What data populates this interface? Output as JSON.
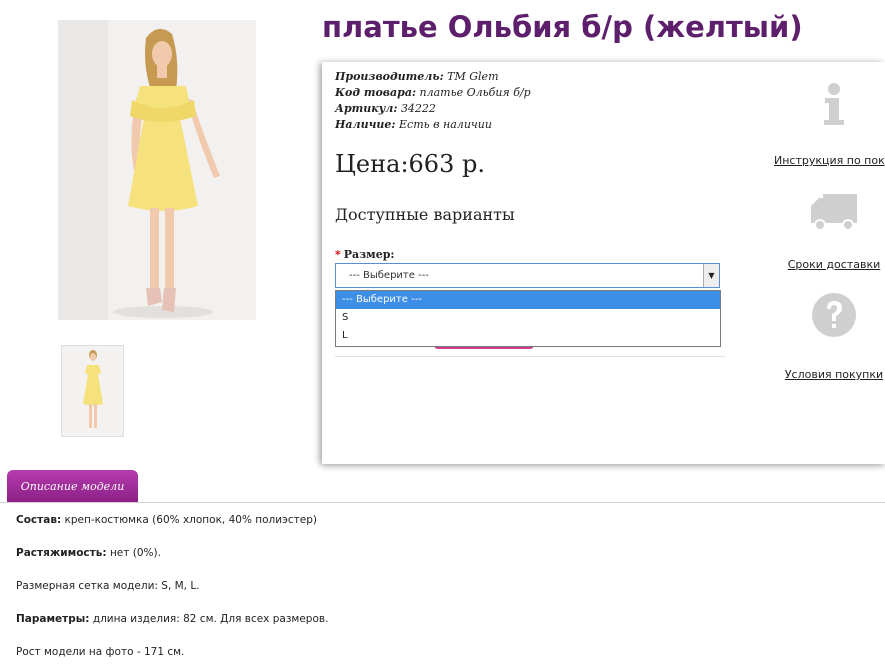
{
  "product": {
    "title": "платье Ольбия б/р (желтый)"
  },
  "specs": {
    "manufacturer_label": "Производитель:",
    "manufacturer_value": "TM Glem",
    "code_label": "Код товара:",
    "code_value": "платье Ольбия б/р",
    "article_label": "Артикул:",
    "article_value": "34222",
    "availability_label": "Наличие:",
    "availability_value": "Есть в наличии"
  },
  "price": "Цена:663 р.",
  "variants_title": "Доступные варианты",
  "size": {
    "required_mark": "*",
    "label": "Размер:",
    "selected": "--- Выберите ---",
    "options": [
      "--- Выберите ---",
      "S",
      "L"
    ]
  },
  "side_links": {
    "instruction": "Инструкция по покупке",
    "delivery": "Сроки доставки",
    "terms": "Условия покупки"
  },
  "tabs": {
    "description": "Описание модели"
  },
  "description": {
    "composition_label": "Состав:",
    "composition_value": "креп-костюмка (60% хлопок, 40% полиэстер)",
    "stretch_label": "Растяжимость:",
    "stretch_value": "нет (0%).",
    "size_grid": "Размерная сетка модели: S, M, L.",
    "params_label": "Параметры:",
    "params_value": "длина изделия: 82 см. Для всех размеров.",
    "model_height": "Рост модели на фото - 171 см."
  },
  "colors": {
    "title": "#5d1f6c",
    "tab_gradient_top": "#b53cad",
    "tab_gradient_bottom": "#8b1f86",
    "dress": "#f5e27d",
    "selected_option": "#3d8ee6",
    "icon_gray": "#cfcfcf"
  }
}
